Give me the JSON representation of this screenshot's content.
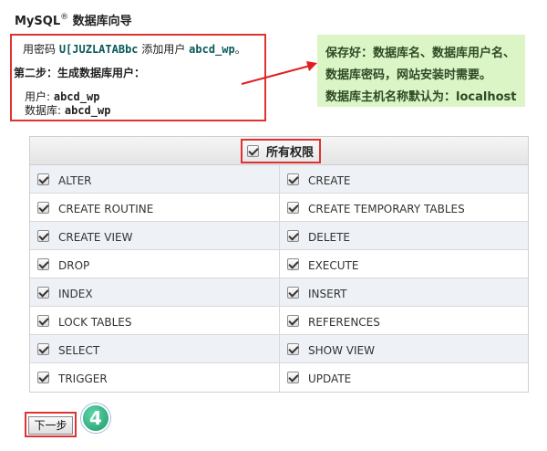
{
  "header": {
    "title_prefix": "MySQL",
    "title_sup": "®",
    "title_suffix": " 数据库向导"
  },
  "info": {
    "line1_a": "用密码 ",
    "password": "U[JUZLATABbc",
    "line1_b": " 添加用户 ",
    "username": "abcd_wp",
    "line1_c": "。",
    "step2": "第二步：生成数据库用户：",
    "user_label": "用户: ",
    "user_value": "abcd_wp",
    "db_label": "数据库: ",
    "db_value": "abcd_wp"
  },
  "note": {
    "line1": "保存好：数据库名、数据库用户名、",
    "line2": "数据库密码，网站安装时需要。",
    "line3": "数据库主机名称默认为：localhost"
  },
  "table": {
    "all_label": "所有权限",
    "rows": [
      [
        "ALTER",
        "CREATE"
      ],
      [
        "CREATE ROUTINE",
        "CREATE TEMPORARY TABLES"
      ],
      [
        "CREATE VIEW",
        "DELETE"
      ],
      [
        "DROP",
        "EXECUTE"
      ],
      [
        "INDEX",
        "INSERT"
      ],
      [
        "LOCK TABLES",
        "REFERENCES"
      ],
      [
        "SELECT",
        "SHOW VIEW"
      ],
      [
        "TRIGGER",
        "UPDATE"
      ]
    ]
  },
  "footer": {
    "next_label": "下一步",
    "step_number": "4"
  },
  "colors": {
    "highlight_border": "#dd3333",
    "note_bg": "#dcf5c6",
    "row_alt": "#eef1f6"
  }
}
